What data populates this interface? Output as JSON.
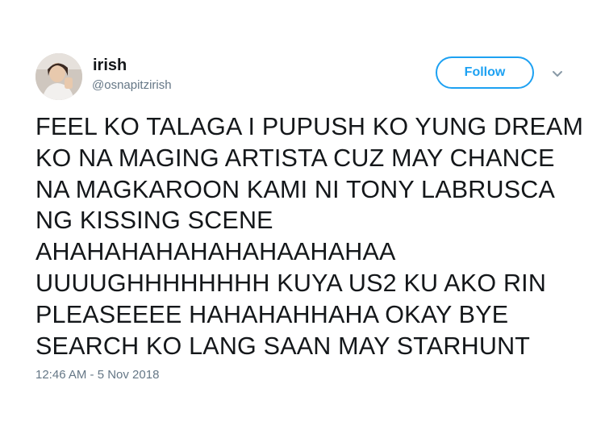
{
  "author": {
    "display_name": "irish",
    "handle": "@osnapitzirish"
  },
  "actions": {
    "follow_label": "Follow",
    "more_icon": "chevron-down-icon"
  },
  "tweet": {
    "lines": [
      "FEEL KO TALAGA I PUPUSH KO YUNG DREAM",
      "KO NA MAGING ARTISTA CUZ MAY CHANCE",
      "NA MAGKAROON KAMI NI TONY LABRUSCA",
      "NG KISSING SCENE",
      "AHAHAHAHAHAHAHAAHAHAA",
      "UUUUGHHHHHHHH KUYA US2 KU AKO RIN",
      "PLEASEEEE HAHAHAHHAHA OKAY BYE",
      "SEARCH KO LANG SAAN MAY STARHUNT"
    ],
    "timestamp": "12:46 AM - 5 Nov 2018"
  },
  "colors": {
    "accent": "#1da1f2",
    "secondary_text": "#657786",
    "primary_text": "#14171a"
  }
}
